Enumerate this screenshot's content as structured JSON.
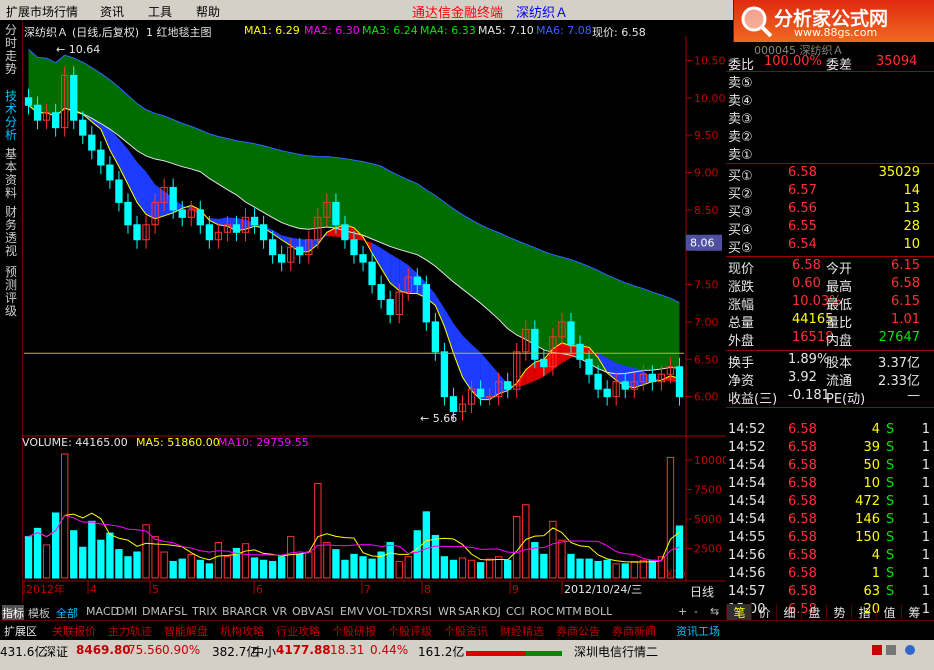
{
  "menu": {
    "items": [
      "扩展市场行情",
      "资讯",
      "工具",
      "帮助"
    ],
    "app_title": "通达信金融终端",
    "stock_title": "深纺织Ａ",
    "logo_main": "分析家公式网",
    "logo_url": "www.88gs.com"
  },
  "left_tabs": [
    {
      "label": "分时走势",
      "active": false
    },
    {
      "label": "技术分析",
      "active": true
    },
    {
      "label": "基本资料",
      "active": false
    },
    {
      "label": "财务透视",
      "active": false
    },
    {
      "label": "预测评级",
      "active": false
    }
  ],
  "chart_header": {
    "name": "深纺织Ａ",
    "period": "(日线,后复权)",
    "formula": "1 红地毯主图",
    "ma": [
      {
        "label": "MA1: 6.29",
        "color": "#ffff00"
      },
      {
        "label": "MA2: 6.30",
        "color": "#ff00ff"
      },
      {
        "label": "MA3: 6.24",
        "color": "#00e600"
      },
      {
        "label": "MA4: 6.33",
        "color": "#00e600"
      },
      {
        "label": "MA5: 7.10",
        "color": "#e6e6e6"
      },
      {
        "label": "MA6: 7.08",
        "color": "#3264ff"
      },
      {
        "label": "现价: 6.58",
        "color": "#e6e6e6"
      }
    ],
    "high_marker": "10.64",
    "low_marker": "5.66",
    "price_box": "8.06"
  },
  "price_axis": {
    "ticks": [
      "10.50",
      "10.00",
      "9.50",
      "9.00",
      "8.50",
      "8.00",
      "7.50",
      "7.00",
      "6.50",
      "6.00"
    ],
    "min": 5.5,
    "max": 10.8
  },
  "volume_header": {
    "volume": "VOLUME: 44165.00",
    "ma5": "MA5: 51860.00",
    "ma10": "MA10: 29759.55"
  },
  "volume_axis": {
    "ticks": [
      "10000",
      "7500",
      "5000",
      "2500"
    ],
    "unit": "X10"
  },
  "date_labels": [
    "2012年",
    "4",
    "5",
    "6",
    "7",
    "8",
    "9",
    "2012/10/24/三"
  ],
  "period_label": "日线",
  "chart_data": {
    "type": "candlestick",
    "close": [
      9.9,
      9.7,
      9.8,
      9.6,
      10.3,
      9.7,
      9.5,
      9.3,
      9.1,
      8.9,
      8.6,
      8.3,
      8.1,
      8.3,
      8.6,
      8.8,
      8.5,
      8.4,
      8.5,
      8.3,
      8.1,
      8.2,
      8.3,
      8.2,
      8.4,
      8.3,
      8.1,
      7.9,
      7.8,
      8.0,
      7.9,
      8.1,
      8.4,
      8.6,
      8.3,
      8.1,
      7.9,
      7.8,
      7.5,
      7.3,
      7.1,
      7.4,
      7.6,
      7.5,
      7.0,
      6.6,
      6.0,
      5.8,
      5.9,
      6.1,
      6.0,
      6.0,
      6.2,
      6.1,
      6.6,
      6.9,
      6.5,
      6.4,
      6.8,
      7.0,
      6.7,
      6.5,
      6.3,
      6.1,
      6.0,
      6.2,
      6.1,
      6.2,
      6.3,
      6.2,
      6.3,
      6.4,
      6.0
    ],
    "volume": [
      3500,
      4200,
      2800,
      5500,
      10500,
      4000,
      2600,
      4800,
      3200,
      3800,
      2400,
      1800,
      2200,
      4500,
      3500,
      2200,
      1400,
      1600,
      2000,
      1500,
      1200,
      3000,
      1800,
      2500,
      2900,
      1700,
      1500,
      1400,
      1800,
      3500,
      2000,
      2200,
      8000,
      3000,
      2400,
      1500,
      2000,
      1800,
      1600,
      2200,
      3000,
      1400,
      1800,
      4000,
      5600,
      3600,
      1800,
      1500,
      1700,
      1500,
      1300,
      1600,
      1800,
      1500,
      5200,
      6200,
      3000,
      2000,
      4800,
      3200,
      2000,
      1600,
      1600,
      1400,
      1500,
      1200,
      1200,
      1400,
      1500,
      1500,
      1800,
      10200,
      4400
    ]
  },
  "quote": {
    "stock_code": "000045 深纺织Ａ",
    "weibi": "100.00%",
    "weicha_label": "委差",
    "weicha": "35094",
    "weibi_label": "委比",
    "sell": [
      {
        "label": "卖⑤",
        "price": "",
        "vol": ""
      },
      {
        "label": "卖④",
        "price": "",
        "vol": ""
      },
      {
        "label": "卖③",
        "price": "",
        "vol": ""
      },
      {
        "label": "卖②",
        "price": "",
        "vol": ""
      },
      {
        "label": "卖①",
        "price": "",
        "vol": ""
      }
    ],
    "buy": [
      {
        "label": "买①",
        "price": "6.58",
        "vol": "35029"
      },
      {
        "label": "买②",
        "price": "6.57",
        "vol": "14"
      },
      {
        "label": "买③",
        "price": "6.56",
        "vol": "13"
      },
      {
        "label": "买④",
        "price": "6.55",
        "vol": "28"
      },
      {
        "label": "买⑤",
        "price": "6.54",
        "vol": "10"
      }
    ],
    "stats": [
      {
        "l1": "现价",
        "v1": "6.58",
        "c1": "#ff3232",
        "l2": "今开",
        "v2": "6.15",
        "c2": "#ff3232"
      },
      {
        "l1": "涨跌",
        "v1": "0.60",
        "c1": "#ff3232",
        "l2": "最高",
        "v2": "6.58",
        "c2": "#ff3232"
      },
      {
        "l1": "涨幅",
        "v1": "10.03%",
        "c1": "#ff3232",
        "l2": "最低",
        "v2": "6.15",
        "c2": "#ff3232"
      },
      {
        "l1": "总量",
        "v1": "44165",
        "c1": "#ffff00",
        "l2": "量比",
        "v2": "1.01",
        "c2": "#ff3232"
      },
      {
        "l1": "外盘",
        "v1": "16518",
        "c1": "#ff3232",
        "l2": "内盘",
        "v2": "27647",
        "c2": "#00e600"
      }
    ],
    "stats2": [
      {
        "l1": "换手",
        "v1": "1.89%",
        "l2": "股本",
        "v2": "3.37亿"
      },
      {
        "l1": "净资",
        "v1": "3.92",
        "l2": "流通",
        "v2": "2.33亿"
      },
      {
        "l1": "收益(三)",
        "v1": "-0.181",
        "l2": "PE(动)",
        "v2": "—"
      }
    ],
    "ticks": [
      {
        "time": "14:52",
        "price": "6.58",
        "vol": "4",
        "side": "S",
        "n": "1"
      },
      {
        "time": "14:52",
        "price": "6.58",
        "vol": "39",
        "side": "S",
        "n": "1"
      },
      {
        "time": "14:54",
        "price": "6.58",
        "vol": "50",
        "side": "S",
        "n": "1"
      },
      {
        "time": "14:54",
        "price": "6.58",
        "vol": "10",
        "side": "S",
        "n": "1"
      },
      {
        "time": "14:54",
        "price": "6.58",
        "vol": "472",
        "side": "S",
        "n": "1"
      },
      {
        "time": "14:54",
        "price": "6.58",
        "vol": "146",
        "side": "S",
        "n": "1"
      },
      {
        "time": "14:55",
        "price": "6.58",
        "vol": "150",
        "side": "S",
        "n": "1"
      },
      {
        "time": "14:56",
        "price": "6.58",
        "vol": "4",
        "side": "S",
        "n": "1"
      },
      {
        "time": "14:56",
        "price": "6.58",
        "vol": "1",
        "side": "S",
        "n": "1"
      },
      {
        "time": "14:57",
        "price": "6.58",
        "vol": "63",
        "side": "S",
        "n": "1"
      },
      {
        "time": "15:00",
        "price": "6.58",
        "vol": "20",
        "side": "",
        "n": "1"
      }
    ],
    "bottom_tabs": [
      "笔",
      "价",
      "细",
      "盘",
      "势",
      "指",
      "值",
      "筹"
    ]
  },
  "indicator_tabs": [
    "指标",
    "模板",
    "全部",
    "MACD",
    "DMI",
    "DMA",
    "FSL",
    "TRIX",
    "BRAR",
    "CR",
    "VR",
    "OBV",
    "ASI",
    "EMV",
    "VOL-TDX",
    "RSI",
    "WR",
    "SAR",
    "KDJ",
    "CCI",
    "ROC",
    "MTM",
    "BOLL",
    "+",
    "-",
    "⇆"
  ],
  "category_tabs": [
    "扩展区",
    "关联报价",
    "主力轨迹",
    "智能解盘",
    "机构攻略",
    "行业攻略",
    "个股研报",
    "个股评级",
    "个股资讯",
    "财经精选",
    "券商公告",
    "券商新闻",
    "资讯工场"
  ],
  "status": {
    "s0": "431.6亿",
    "s1_label": "深证",
    "s1_val": "8469.80",
    "s1_chg": "75.56",
    "s1_pct": "0.90%",
    "s1_amt": "382.7亿",
    "s2_label": "中小",
    "s2_val": "4177.88",
    "s2_chg": "18.31",
    "s2_pct": "0.44%",
    "s2_amt": "161.2亿",
    "feed": "深圳电信行情二"
  }
}
